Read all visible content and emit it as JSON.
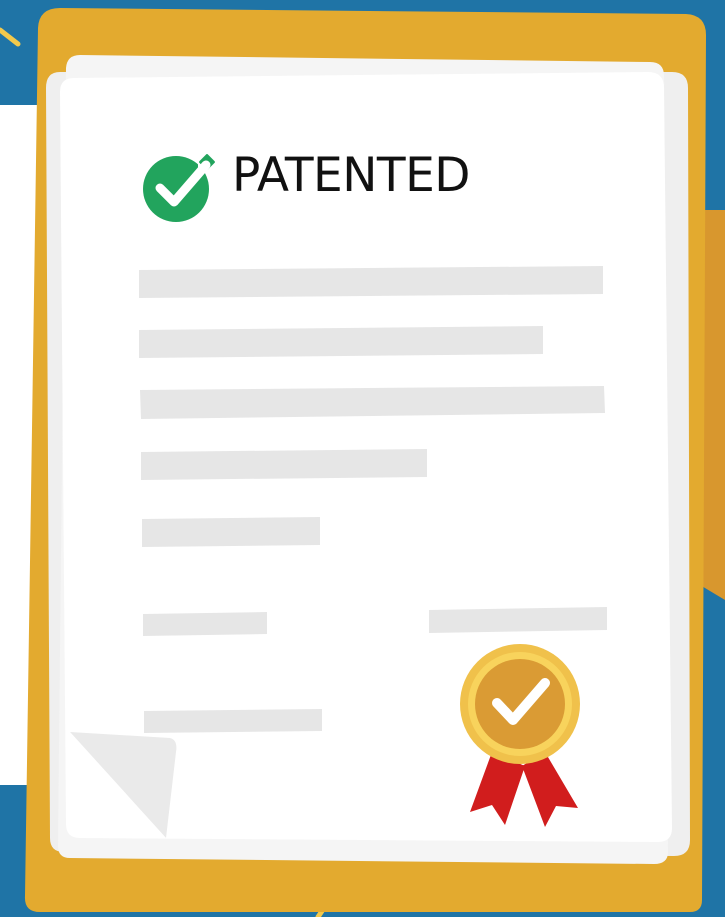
{
  "document": {
    "heading": "PATENTED"
  },
  "icons": {
    "heading_icon": "green-check-badge-icon",
    "seal_icon": "gold-award-ribbon-icon"
  },
  "colors": {
    "background": "#1f74a6",
    "folder": "#e3aa2f",
    "folder_tab": "#d8972e",
    "paper": "#ffffff",
    "paper_back": "#efefef",
    "text_placeholder": "#e6e6e6",
    "check_green": "#22a45d",
    "seal_gold": "#f0c14b",
    "seal_inner": "#da9b34",
    "ribbon_red": "#d11d1d",
    "heading_text": "#111111"
  }
}
